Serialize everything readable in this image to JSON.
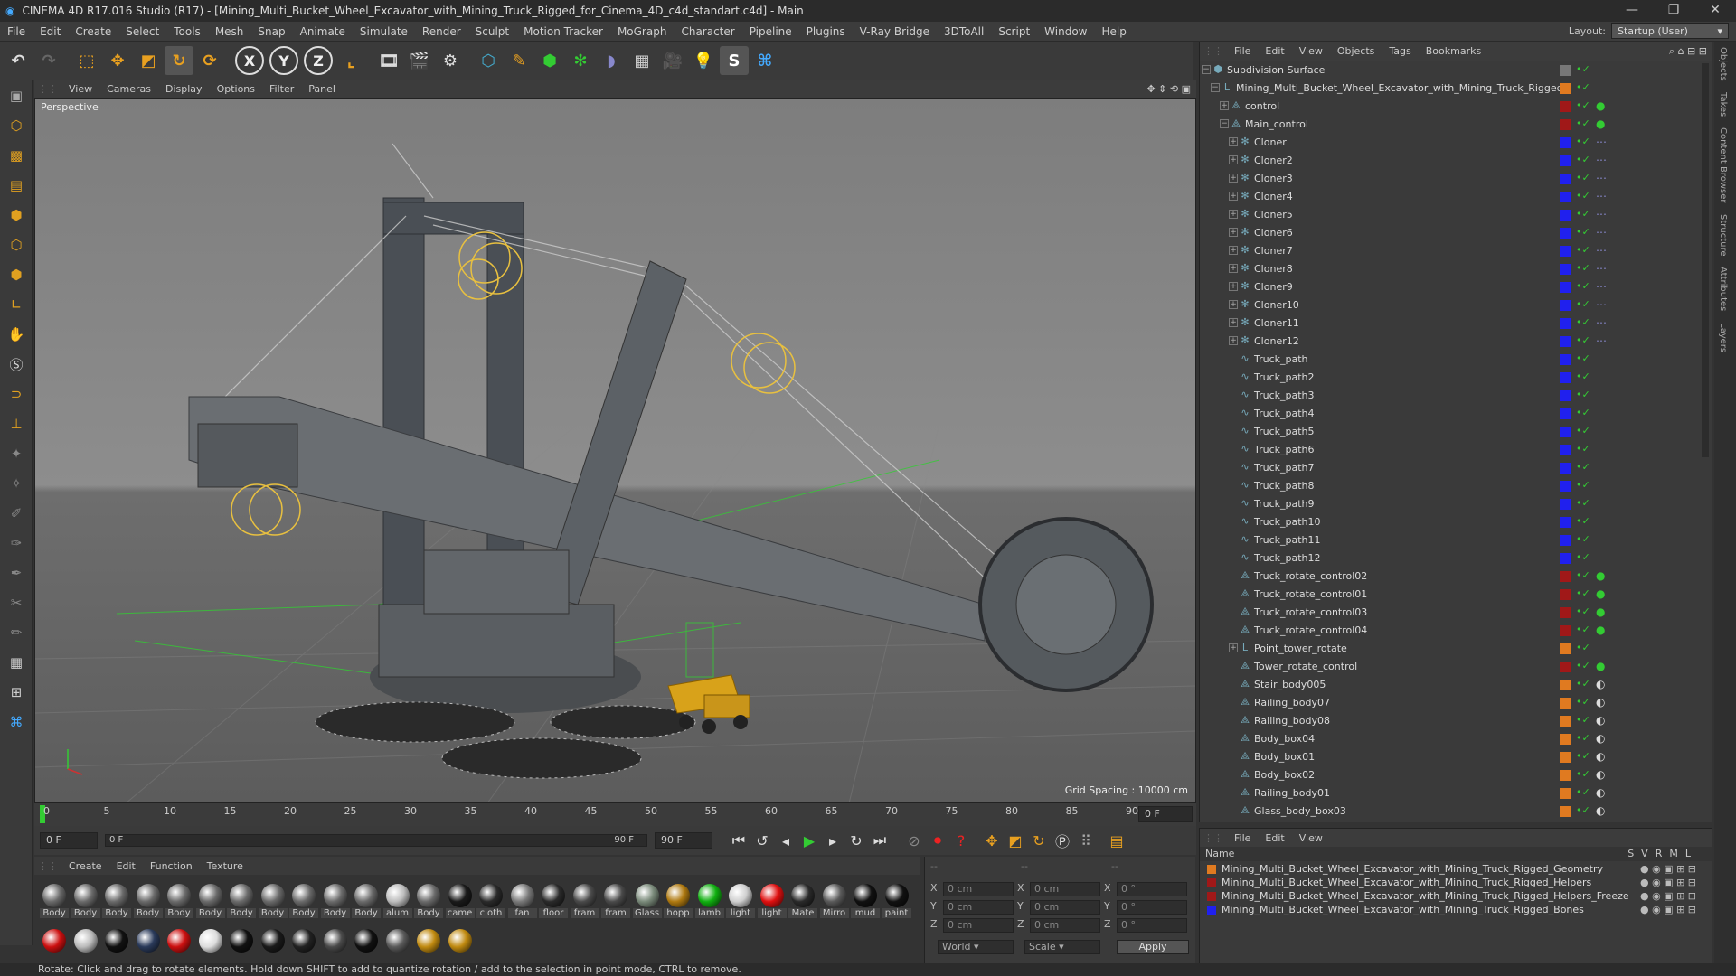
{
  "window": {
    "title": "CINEMA 4D R17.016 Studio (R17) - [Mining_Multi_Bucket_Wheel_Excavator_with_Mining_Truck_Rigged_for_Cinema_4D_c4d_standart.c4d] - Main"
  },
  "menu": [
    "File",
    "Edit",
    "Create",
    "Select",
    "Tools",
    "Mesh",
    "Snap",
    "Animate",
    "Simulate",
    "Render",
    "Sculpt",
    "Motion Tracker",
    "MoGraph",
    "Character",
    "Pipeline",
    "Plugins",
    "V-Ray Bridge",
    "3DToAll",
    "Script",
    "Window",
    "Help"
  ],
  "layout": {
    "label": "Layout:",
    "value": "Startup (User)"
  },
  "toolbar": {
    "axis_x": "X",
    "axis_y": "Y",
    "axis_z": "Z"
  },
  "viewport": {
    "menu": [
      "View",
      "Cameras",
      "Display",
      "Options",
      "Filter",
      "Panel"
    ],
    "label": "Perspective",
    "grid_spacing": "Grid Spacing : 10000 cm"
  },
  "timeline": {
    "ticks": [
      "0",
      "5",
      "10",
      "15",
      "20",
      "25",
      "30",
      "35",
      "40",
      "45",
      "50",
      "55",
      "60",
      "65",
      "70",
      "75",
      "80",
      "85",
      "90"
    ],
    "current_frame": "0 F"
  },
  "playbar": {
    "start": "0 F",
    "slider_left": "0 F",
    "slider_right": "90 F",
    "end": "90 F"
  },
  "materials": {
    "menu": [
      "Create",
      "Edit",
      "Function",
      "Texture"
    ],
    "row1": [
      {
        "label": "Body",
        "color": "#6a6a6a"
      },
      {
        "label": "Body",
        "color": "#6a6a6a"
      },
      {
        "label": "Body",
        "color": "#6a6a6a"
      },
      {
        "label": "Body",
        "color": "#6a6a6a"
      },
      {
        "label": "Body",
        "color": "#6a6a6a"
      },
      {
        "label": "Body",
        "color": "#6a6a6a"
      },
      {
        "label": "Body",
        "color": "#6a6a6a"
      },
      {
        "label": "Body",
        "color": "#6a6a6a"
      },
      {
        "label": "Body",
        "color": "#6a6a6a"
      },
      {
        "label": "Body",
        "color": "#6a6a6a"
      },
      {
        "label": "Body",
        "color": "#6a6a6a"
      },
      {
        "label": "alum",
        "color": "#bdbdbd"
      },
      {
        "label": "Body",
        "color": "#6a6a6a"
      },
      {
        "label": "came",
        "color": "#1a1a1a"
      },
      {
        "label": "cloth",
        "color": "#2a2a2a"
      },
      {
        "label": "fan",
        "color": "#7a7a7a"
      },
      {
        "label": "floor",
        "color": "#2a2a2a"
      },
      {
        "label": "fram",
        "color": "#4a4a4a"
      },
      {
        "label": "fram",
        "color": "#4a4a4a"
      },
      {
        "label": "Glass",
        "color": "#7a8a7a"
      },
      {
        "label": "hopp",
        "color": "#b07a10"
      },
      {
        "label": "lamb",
        "color": "#10b010"
      },
      {
        "label": "light",
        "color": "#cfcfcf"
      },
      {
        "label": "light",
        "color": "#e01010"
      },
      {
        "label": "Mate",
        "color": "#2a2a2a"
      },
      {
        "label": "Mirro",
        "color": "#5a5a5a"
      },
      {
        "label": "mud",
        "color": "#111111"
      },
      {
        "label": "paint",
        "color": "#111111"
      }
    ],
    "row2": [
      {
        "color": "#cc1010"
      },
      {
        "color": "#bbbbbb"
      },
      {
        "color": "#111111"
      },
      {
        "color": "#2a3a5a"
      },
      {
        "color": "#cc1010"
      },
      {
        "color": "#dddddd"
      },
      {
        "color": "#111111"
      },
      {
        "color": "#1a1a1a"
      },
      {
        "color": "#222222"
      },
      {
        "color": "#4a4a4a"
      },
      {
        "color": "#111111"
      },
      {
        "color": "#5a5a5a"
      },
      {
        "color": "#c08a10"
      },
      {
        "color": "#c08a10"
      }
    ]
  },
  "coords": {
    "headers": [
      "--",
      "--",
      "--"
    ],
    "rows": [
      {
        "a": "X",
        "v1": "0 cm",
        "b": "X",
        "v2": "0 cm",
        "c": "X",
        "v3": "0 °"
      },
      {
        "a": "Y",
        "v1": "0 cm",
        "b": "Y",
        "v2": "0 cm",
        "c": "Y",
        "v3": "0 °"
      },
      {
        "a": "Z",
        "v1": "0 cm",
        "b": "Z",
        "v2": "0 cm",
        "c": "Z",
        "v3": "0 °"
      }
    ],
    "mode": "World",
    "scale": "Scale",
    "apply": "Apply"
  },
  "objects": {
    "menu": [
      "File",
      "Edit",
      "View",
      "Objects",
      "Tags",
      "Bookmarks"
    ],
    "items": [
      {
        "name": "Subdivision Surface",
        "indent": 0,
        "icon": "⬢",
        "color": "#777777",
        "tags": ""
      },
      {
        "name": "Mining_Multi_Bucket_Wheel_Excavator_with_Mining_Truck_Rigged",
        "indent": 1,
        "icon": "L",
        "color": "#e07a20",
        "tags": ""
      },
      {
        "name": "control",
        "indent": 2,
        "icon": "⟁",
        "color": "#a01818",
        "tags": "●"
      },
      {
        "name": "Main_control",
        "indent": 2,
        "icon": "⟁",
        "color": "#a01818",
        "tags": "●"
      },
      {
        "name": "Cloner",
        "indent": 3,
        "icon": "✻",
        "color": "#2020ee",
        "tags": "⋯"
      },
      {
        "name": "Cloner2",
        "indent": 3,
        "icon": "✻",
        "color": "#2020ee",
        "tags": "⋯"
      },
      {
        "name": "Cloner3",
        "indent": 3,
        "icon": "✻",
        "color": "#2020ee",
        "tags": "⋯"
      },
      {
        "name": "Cloner4",
        "indent": 3,
        "icon": "✻",
        "color": "#2020ee",
        "tags": "⋯"
      },
      {
        "name": "Cloner5",
        "indent": 3,
        "icon": "✻",
        "color": "#2020ee",
        "tags": "⋯"
      },
      {
        "name": "Cloner6",
        "indent": 3,
        "icon": "✻",
        "color": "#2020ee",
        "tags": "⋯"
      },
      {
        "name": "Cloner7",
        "indent": 3,
        "icon": "✻",
        "color": "#2020ee",
        "tags": "⋯"
      },
      {
        "name": "Cloner8",
        "indent": 3,
        "icon": "✻",
        "color": "#2020ee",
        "tags": "⋯"
      },
      {
        "name": "Cloner9",
        "indent": 3,
        "icon": "✻",
        "color": "#2020ee",
        "tags": "⋯"
      },
      {
        "name": "Cloner10",
        "indent": 3,
        "icon": "✻",
        "color": "#2020ee",
        "tags": "⋯"
      },
      {
        "name": "Cloner11",
        "indent": 3,
        "icon": "✻",
        "color": "#2020ee",
        "tags": "⋯"
      },
      {
        "name": "Cloner12",
        "indent": 3,
        "icon": "✻",
        "color": "#2020ee",
        "tags": "⋯"
      },
      {
        "name": "Truck_path",
        "indent": 3,
        "icon": "∿",
        "color": "#2020ee",
        "tags": ""
      },
      {
        "name": "Truck_path2",
        "indent": 3,
        "icon": "∿",
        "color": "#2020ee",
        "tags": ""
      },
      {
        "name": "Truck_path3",
        "indent": 3,
        "icon": "∿",
        "color": "#2020ee",
        "tags": ""
      },
      {
        "name": "Truck_path4",
        "indent": 3,
        "icon": "∿",
        "color": "#2020ee",
        "tags": ""
      },
      {
        "name": "Truck_path5",
        "indent": 3,
        "icon": "∿",
        "color": "#2020ee",
        "tags": ""
      },
      {
        "name": "Truck_path6",
        "indent": 3,
        "icon": "∿",
        "color": "#2020ee",
        "tags": ""
      },
      {
        "name": "Truck_path7",
        "indent": 3,
        "icon": "∿",
        "color": "#2020ee",
        "tags": ""
      },
      {
        "name": "Truck_path8",
        "indent": 3,
        "icon": "∿",
        "color": "#2020ee",
        "tags": ""
      },
      {
        "name": "Truck_path9",
        "indent": 3,
        "icon": "∿",
        "color": "#2020ee",
        "tags": ""
      },
      {
        "name": "Truck_path10",
        "indent": 3,
        "icon": "∿",
        "color": "#2020ee",
        "tags": ""
      },
      {
        "name": "Truck_path11",
        "indent": 3,
        "icon": "∿",
        "color": "#2020ee",
        "tags": ""
      },
      {
        "name": "Truck_path12",
        "indent": 3,
        "icon": "∿",
        "color": "#2020ee",
        "tags": ""
      },
      {
        "name": "Truck_rotate_control02",
        "indent": 3,
        "icon": "⟁",
        "color": "#a01818",
        "tags": "●"
      },
      {
        "name": "Truck_rotate_control01",
        "indent": 3,
        "icon": "⟁",
        "color": "#a01818",
        "tags": "●"
      },
      {
        "name": "Truck_rotate_control03",
        "indent": 3,
        "icon": "⟁",
        "color": "#a01818",
        "tags": "●"
      },
      {
        "name": "Truck_rotate_control04",
        "indent": 3,
        "icon": "⟁",
        "color": "#a01818",
        "tags": "●"
      },
      {
        "name": "Point_tower_rotate",
        "indent": 3,
        "icon": "L",
        "color": "#e07a20",
        "tags": ""
      },
      {
        "name": "Tower_rotate_control",
        "indent": 3,
        "icon": "⟁",
        "color": "#a01818",
        "tags": "●"
      },
      {
        "name": "Stair_body005",
        "indent": 3,
        "icon": "⟁",
        "color": "#e07a20",
        "tags": "◐"
      },
      {
        "name": "Railing_body07",
        "indent": 3,
        "icon": "⟁",
        "color": "#e07a20",
        "tags": "◐"
      },
      {
        "name": "Railing_body08",
        "indent": 3,
        "icon": "⟁",
        "color": "#e07a20",
        "tags": "◐"
      },
      {
        "name": "Body_box04",
        "indent": 3,
        "icon": "⟁",
        "color": "#e07a20",
        "tags": "◐"
      },
      {
        "name": "Body_box01",
        "indent": 3,
        "icon": "⟁",
        "color": "#e07a20",
        "tags": "◐"
      },
      {
        "name": "Body_box02",
        "indent": 3,
        "icon": "⟁",
        "color": "#e07a20",
        "tags": "◐"
      },
      {
        "name": "Railing_body01",
        "indent": 3,
        "icon": "⟁",
        "color": "#e07a20",
        "tags": "◐"
      },
      {
        "name": "Glass_body_box03",
        "indent": 3,
        "icon": "⟁",
        "color": "#e07a20",
        "tags": "◐"
      }
    ]
  },
  "layers": {
    "menu": [
      "File",
      "Edit",
      "View"
    ],
    "header_name": "Name",
    "header_flags": [
      "S",
      "V",
      "R",
      "M",
      "L"
    ],
    "items": [
      {
        "name": "Mining_Multi_Bucket_Wheel_Excavator_with_Mining_Truck_Rigged_Geometry",
        "color": "#e07a20"
      },
      {
        "name": "Mining_Multi_Bucket_Wheel_Excavator_with_Mining_Truck_Rigged_Helpers",
        "color": "#a01818"
      },
      {
        "name": "Mining_Multi_Bucket_Wheel_Excavator_with_Mining_Truck_Rigged_Helpers_Freeze",
        "color": "#a01818"
      },
      {
        "name": "Mining_Multi_Bucket_Wheel_Excavator_with_Mining_Truck_Rigged_Bones",
        "color": "#2020ee"
      }
    ]
  },
  "side_tabs": [
    "Objects",
    "Takes",
    "Content Browser",
    "Structure",
    "Attributes",
    "Layers"
  ],
  "status": "Rotate: Click and drag to rotate elements. Hold down SHIFT to add to quantize rotation / add to the selection in point mode, CTRL to remove."
}
